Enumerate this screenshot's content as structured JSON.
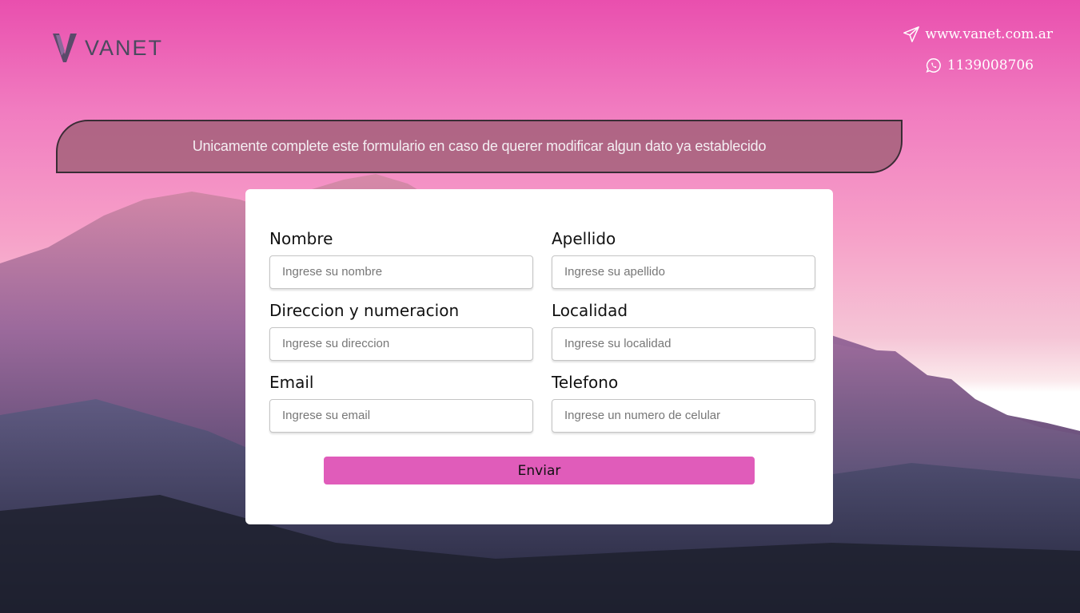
{
  "brand": {
    "name": "VANET",
    "logo_icon": "v-logo-icon"
  },
  "contact": {
    "website": "www.vanet.com.ar",
    "website_icon": "paper-plane-icon",
    "phone": "1139008706",
    "phone_icon": "whatsapp-icon"
  },
  "notice": "Unicamente complete este formulario en caso de querer modificar algun dato ya establecido",
  "form": {
    "fields": [
      {
        "label": "Nombre",
        "placeholder": "Ingrese su nombre"
      },
      {
        "label": "Apellido",
        "placeholder": "Ingrese su apellido"
      },
      {
        "label": "Direccion y numeracion",
        "placeholder": "Ingrese su direccion"
      },
      {
        "label": "Localidad",
        "placeholder": "Ingrese su localidad"
      },
      {
        "label": "Email",
        "placeholder": "Ingrese su email"
      },
      {
        "label": "Telefono",
        "placeholder": "Ingrese un numero de celular"
      }
    ],
    "submit_label": "Enviar"
  },
  "colors": {
    "accent": "#e05cba",
    "notice_bg": "#965a6e"
  }
}
